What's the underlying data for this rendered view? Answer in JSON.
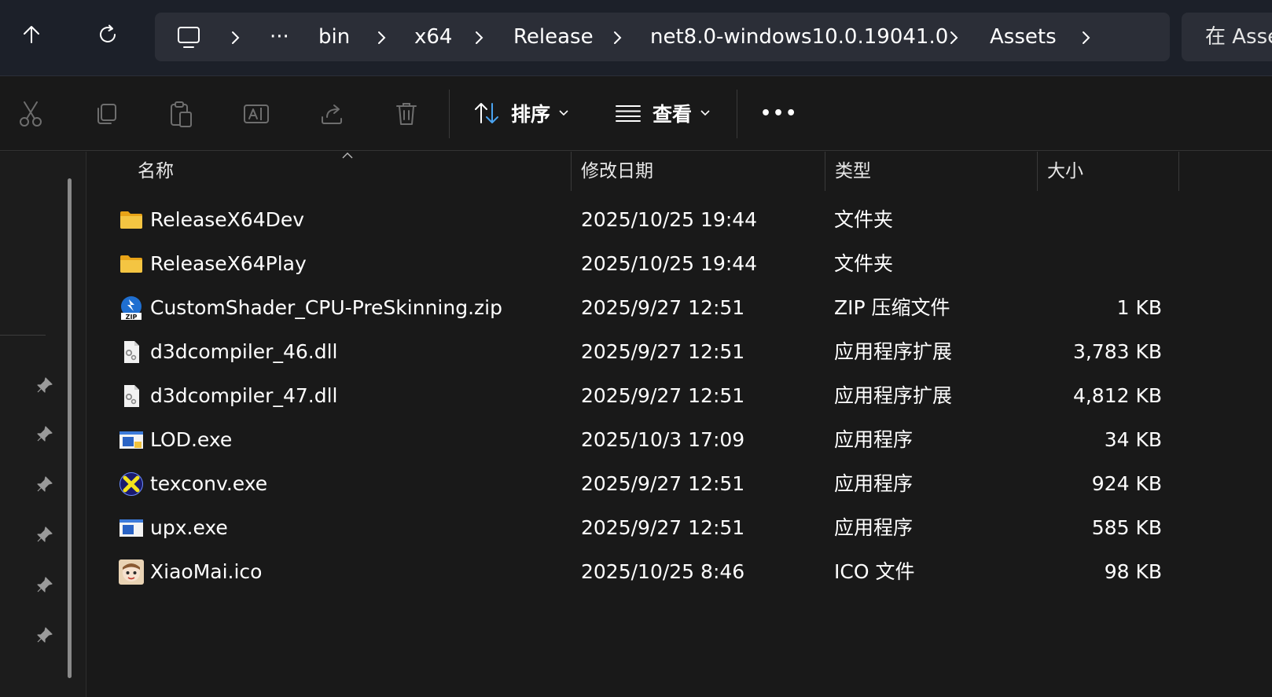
{
  "address_bar": {
    "crumbs": [
      "bin",
      "x64",
      "Release",
      "net8.0-windows10.0.19041.0",
      "Assets"
    ],
    "ellipsis": "···",
    "search_placeholder": "在 Assets 中搜索"
  },
  "command_bar": {
    "sort_label": "排序",
    "view_label": "查看",
    "more_label": "•••"
  },
  "columns": {
    "name": "名称",
    "date": "修改日期",
    "type": "类型",
    "size": "大小"
  },
  "files": [
    {
      "name": "ReleaseX64Dev",
      "date": "2025/10/25 19:44",
      "type": "文件夹",
      "size": "",
      "icon": "folder-icon"
    },
    {
      "name": "ReleaseX64Play",
      "date": "2025/10/25 19:44",
      "type": "文件夹",
      "size": "",
      "icon": "folder-icon"
    },
    {
      "name": "CustomShader_CPU-PreSkinning.zip",
      "date": "2025/9/27 12:51",
      "type": "ZIP 压缩文件",
      "size": "1 KB",
      "icon": "zip-icon"
    },
    {
      "name": "d3dcompiler_46.dll",
      "date": "2025/9/27 12:51",
      "type": "应用程序扩展",
      "size": "3,783 KB",
      "icon": "dll-icon"
    },
    {
      "name": "d3dcompiler_47.dll",
      "date": "2025/9/27 12:51",
      "type": "应用程序扩展",
      "size": "4,812 KB",
      "icon": "dll-icon"
    },
    {
      "name": "LOD.exe",
      "date": "2025/10/3 17:09",
      "type": "应用程序",
      "size": "34 KB",
      "icon": "exe-window-icon"
    },
    {
      "name": "texconv.exe",
      "date": "2025/9/27 12:51",
      "type": "应用程序",
      "size": "924 KB",
      "icon": "directx-icon"
    },
    {
      "name": "upx.exe",
      "date": "2025/9/27 12:51",
      "type": "应用程序",
      "size": "585 KB",
      "icon": "exe-window-icon"
    },
    {
      "name": "XiaoMai.ico",
      "date": "2025/10/25 8:46",
      "type": "ICO 文件",
      "size": "98 KB",
      "icon": "avatar-image-icon"
    }
  ],
  "colors": {
    "accent": "#0078d4",
    "folder": "#f4c542",
    "background": "#191919"
  }
}
